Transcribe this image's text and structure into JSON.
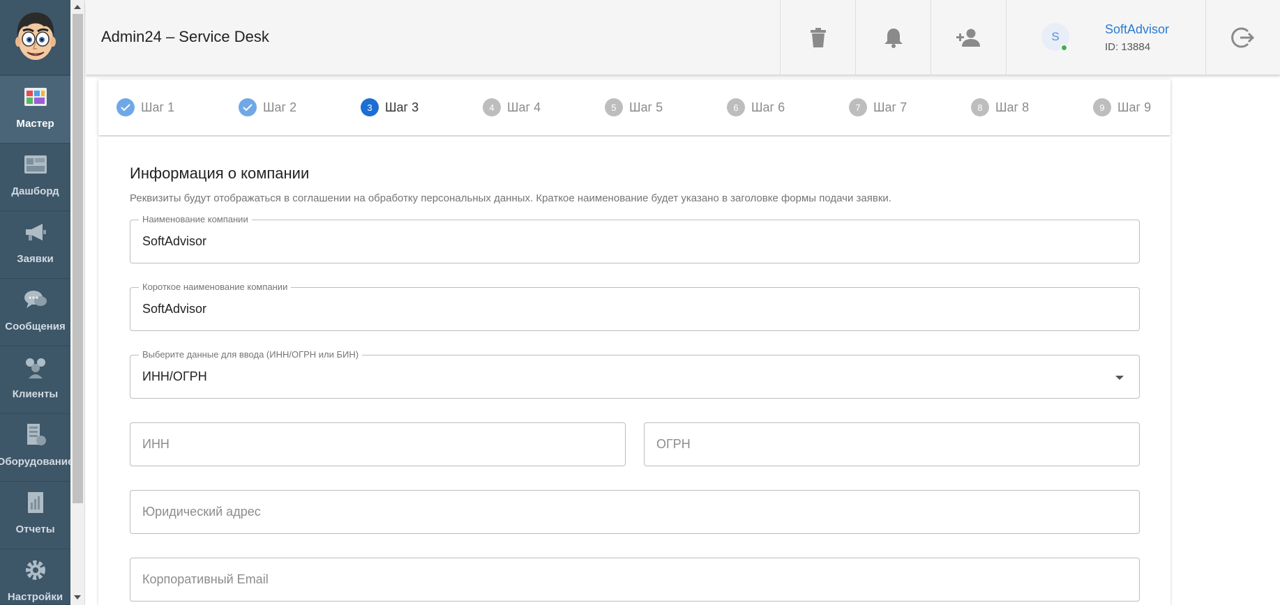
{
  "header": {
    "app_title": "Admin24 – Service Desk",
    "user": {
      "avatar_initial": "S",
      "name": "SoftAdvisor",
      "id_text": "ID: 13884"
    },
    "icons": [
      "trash-icon",
      "bell-icon",
      "add-user-icon",
      "logout-icon"
    ]
  },
  "sidebar": {
    "items": [
      {
        "label": "Мастер",
        "icon": "wizard-icon",
        "active": true
      },
      {
        "label": "Дашборд",
        "icon": "dashboard-icon",
        "active": false
      },
      {
        "label": "Заявки",
        "icon": "megaphone-icon",
        "active": false
      },
      {
        "label": "Сообщения",
        "icon": "chat-icon",
        "active": false
      },
      {
        "label": "Клиенты",
        "icon": "clients-icon",
        "active": false
      },
      {
        "label": "Оборудование",
        "icon": "equipment-icon",
        "active": false
      },
      {
        "label": "Отчеты",
        "icon": "reports-icon",
        "active": false
      },
      {
        "label": "Настройки",
        "icon": "gear-icon",
        "active": false
      }
    ]
  },
  "stepper": {
    "steps": [
      {
        "num": "1",
        "label": "Шаг 1",
        "state": "done"
      },
      {
        "num": "2",
        "label": "Шаг 2",
        "state": "done"
      },
      {
        "num": "3",
        "label": "Шаг 3",
        "state": "active"
      },
      {
        "num": "4",
        "label": "Шаг 4",
        "state": "pending"
      },
      {
        "num": "5",
        "label": "Шаг 5",
        "state": "pending"
      },
      {
        "num": "6",
        "label": "Шаг 6",
        "state": "pending"
      },
      {
        "num": "7",
        "label": "Шаг 7",
        "state": "pending"
      },
      {
        "num": "8",
        "label": "Шаг 8",
        "state": "pending"
      },
      {
        "num": "9",
        "label": "Шаг 9",
        "state": "pending"
      }
    ]
  },
  "form": {
    "title": "Информация о компании",
    "description": "Реквизиты будут отображаться в соглашении на обработку персональных данных. Краткое наименование будет указано в заголовке формы подачи заявки.",
    "company_name": {
      "label": "Наименование компании",
      "value": "SoftAdvisor"
    },
    "short_name": {
      "label": "Короткое наименование компании",
      "value": "SoftAdvisor"
    },
    "id_type": {
      "label": "Выберите данные для ввода (ИНН/ОГРН или БИН)",
      "value": "ИНН/ОГРН"
    },
    "inn": {
      "placeholder": "ИНН"
    },
    "ogrn": {
      "placeholder": "ОГРН"
    },
    "legal_address": {
      "placeholder": "Юридический адрес"
    },
    "corporate_email": {
      "placeholder": "Корпоративный Email"
    }
  },
  "colors": {
    "sidebar_bg": "#3d5668",
    "accent": "#1d6fd3",
    "step_done": "#6fa8e6",
    "link": "#2a7bd1"
  }
}
